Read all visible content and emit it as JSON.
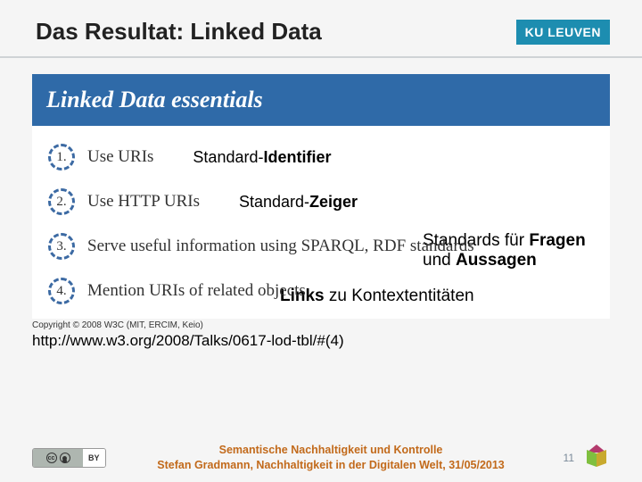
{
  "header": {
    "title": "Das Resultat: Linked Data",
    "badge": "KU LEUVEN"
  },
  "panel": {
    "heading": "Linked Data essentials",
    "points": [
      {
        "num": "1.",
        "text": "Use URIs"
      },
      {
        "num": "2.",
        "text": "Use HTTP URIs"
      },
      {
        "num": "3.",
        "text": "Serve useful information using SPARQL, RDF standards"
      },
      {
        "num": "4.",
        "text": "Mention URIs of related objects"
      }
    ]
  },
  "annotations": {
    "p1_prefix": "Standard-",
    "p1_bold": "Identifier",
    "p2_prefix": "Standard-",
    "p2_bold": "Zeiger",
    "p3_line1_a": "Standards für ",
    "p3_line1_b": "Fragen",
    "p3_line2_a": "und ",
    "p3_line2_b": "Aussagen",
    "p4_bold": "Links",
    "p4_rest": " zu Kontextentitäten"
  },
  "copyright": "Copyright © 2008 W3C (MIT, ERCIM, Keio)",
  "talk_url": "http://www.w3.org/2008/Talks/0617-lod-tbl/#(4)",
  "footer": {
    "cc_label": "BY",
    "line1": "Semantische Nachhaltigkeit und Kontrolle",
    "line2": "Stefan Gradmann, Nachhaltigkeit in der Digitalen Welt, 31/05/2013",
    "page": "11"
  }
}
